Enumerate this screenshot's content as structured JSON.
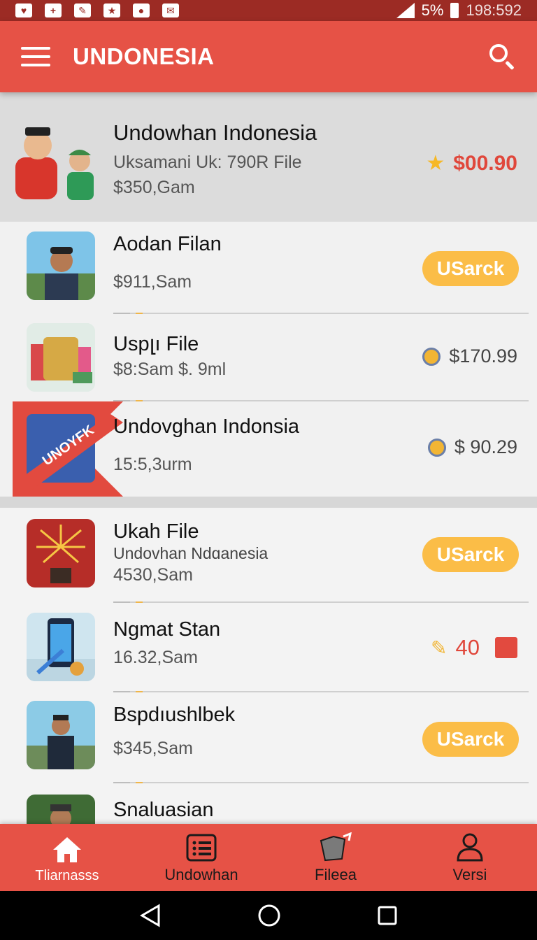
{
  "status": {
    "battery": "5%",
    "clock": "198:592"
  },
  "appbar": {
    "title": "UNDONESIA"
  },
  "featured": {
    "title": "Undowhan Indonesia",
    "line1": "Uksamani  Uk: 790R File",
    "line2": "$350,Gam",
    "price": "$00.90",
    "colors": {
      "price": "#e0473b",
      "star": "#f6b826"
    }
  },
  "items": [
    {
      "name": "Aodan Filan",
      "sub": "$911,Sam",
      "action": "USarck"
    },
    {
      "name": "Uspլı File",
      "sub": "$8:Sam $. 9ml",
      "price": "$170.99"
    },
    {
      "name": "Undovghan Indonsia",
      "sub": "15:5,3urm",
      "price": "$ 90.29",
      "badge": "UNOYFK"
    },
    {
      "name": "Ukah File",
      "sub2": "Undovhan Ndɑanesia",
      "sub": "4530,Sam",
      "action": "USarck"
    },
    {
      "name": "Ngmat Stan",
      "sub": "16.32,Sam",
      "count": "40"
    },
    {
      "name": "Bspdıushlbek",
      "sub": "$345,Sam",
      "action": "USarck"
    },
    {
      "name": "Snaluasian"
    }
  ],
  "nav": [
    {
      "label": "Tliarnasss",
      "icon": "home-icon"
    },
    {
      "label": "Undowhan",
      "icon": "list-icon"
    },
    {
      "label": "Fileea",
      "icon": "folder-icon"
    },
    {
      "label": "Versi",
      "icon": "person-icon"
    }
  ],
  "colors": {
    "appbar": "#e65246",
    "pill": "#fbbd47",
    "statusbar": "#9c2b24"
  }
}
